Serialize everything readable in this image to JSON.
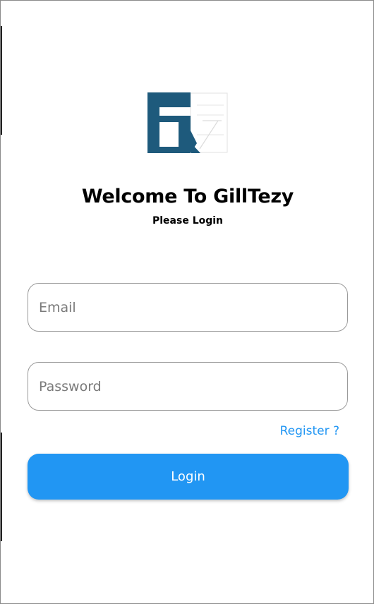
{
  "app": {
    "logo_icon": "gilltezy-logo",
    "title": "Welcome To GillTezy",
    "subtitle": "Please Login"
  },
  "form": {
    "email_placeholder": "Email",
    "password_placeholder": "Password",
    "register_link": "Register ?",
    "login_label": "Login"
  },
  "colors": {
    "accent": "#2196f3",
    "logo_blue": "#1e5a7c",
    "text": "#000000",
    "border": "#9a9a9a"
  }
}
